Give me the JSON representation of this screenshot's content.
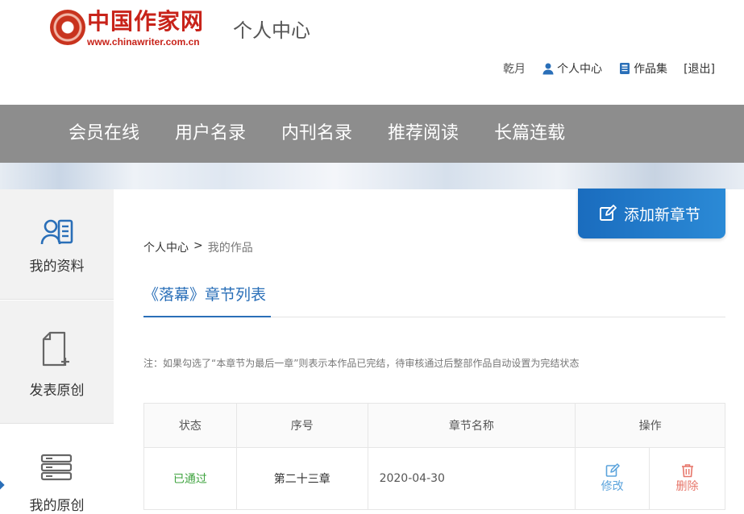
{
  "logo": {
    "cn": "中国作家网",
    "url": "www.chinawriter.com.cn"
  },
  "header": {
    "title": "个人中心",
    "username": "乾月",
    "personal_center": "个人中心",
    "works": "作品集",
    "logout": "[退出]"
  },
  "nav": [
    "会员在线",
    "用户名录",
    "内刊名录",
    "推荐阅读",
    "长篇连载"
  ],
  "sidebar": {
    "items": [
      {
        "label": "我的资料",
        "icon": "profile-card-icon"
      },
      {
        "label": "发表原创",
        "icon": "new-document-icon"
      },
      {
        "label": "我的原创",
        "icon": "server-stack-icon"
      }
    ]
  },
  "actions": {
    "add_chapter": "添加新章节"
  },
  "breadcrumb": {
    "home": "个人中心",
    "sep": ">",
    "current": "我的作品"
  },
  "section": {
    "title": "《落幕》章节列表"
  },
  "note": "注：如果勾选了“本章节为最后一章”则表示本作品已完结，待审核通过后整部作品自动设置为完结状态",
  "table": {
    "headers": [
      "状态",
      "序号",
      "章节名称",
      "操作"
    ],
    "rows": [
      {
        "status": "已通过",
        "chapter": "第二十三章",
        "name": "2020-04-30",
        "edit": "修改",
        "delete": "删除"
      }
    ]
  },
  "colors": {
    "accent": "#2a6fb8",
    "nav_bg": "#8d8d8d",
    "ok": "#3fa33f",
    "delete": "#e7776b"
  }
}
